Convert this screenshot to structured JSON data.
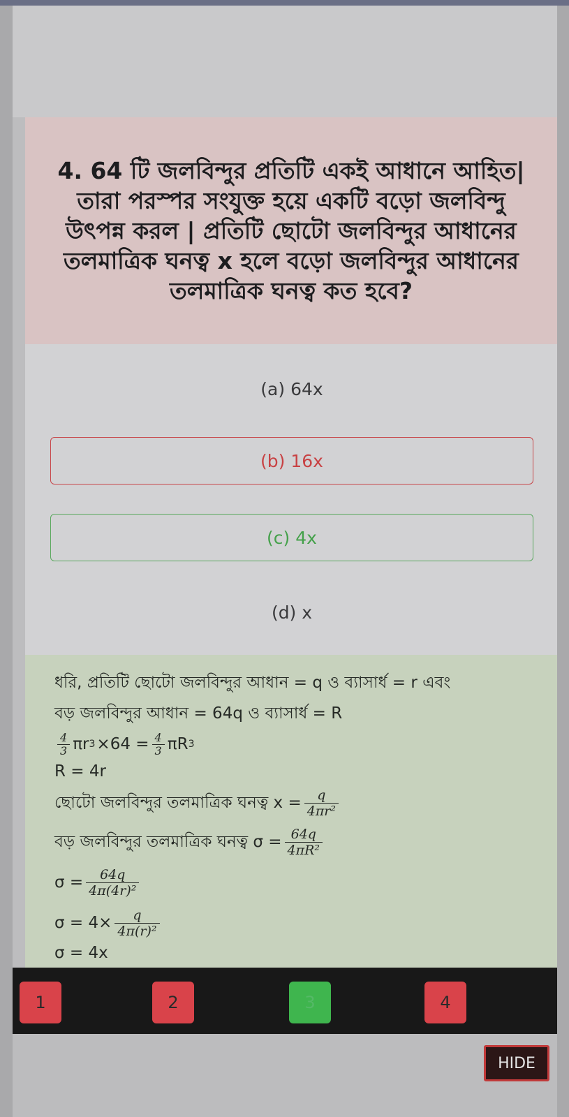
{
  "question": {
    "text": "4. 64 টি জলবিন্দুর প্রতিটি একই আধানে আহিত| তারা পরস্পর সংযুক্ত হয়ে একটি বড়ো জলবিন্দু উৎপন্ন করল | প্রতিটি ছোটো জলবিন্দুর আধানের তলমাত্রিক ঘনত্ব x হলে বড়ো জলবিন্দুর আধানের তলমাত্রিক ঘনত্ব কত হবে?"
  },
  "options": [
    {
      "label": "(a) 64x"
    },
    {
      "label": "(b) 16x"
    },
    {
      "label": "(c) 4x"
    },
    {
      "label": "(d) x"
    }
  ],
  "solution": {
    "line1": "ধরি, প্রতিটি ছোটো জলবিন্দুর আধান = q ও ব্যাসার্ধ = r এবং",
    "line2": "বড় জলবিন্দুর আধান = 64q ও ব্যাসার্ধ = R",
    "eq1_frac_num": "4",
    "eq1_frac_den": "3",
    "eq1_left": "πr",
    "eq1_exp": "3",
    "eq1_mid": "×64 =",
    "eq1_right": "πR",
    "line4": "R = 4r",
    "line5_text": "ছোটো জলবিন্দুর তলমাত্রিক ঘনত্ব x =",
    "line5_num": "q",
    "line5_den": "4πr²",
    "line6_text": "বড় জলবিন্দুর তলমাত্রিক ঘনত্ব σ =",
    "line6_num": "64q",
    "line6_den": "4πR²",
    "line7_text": "σ =",
    "line7_num": "64q",
    "line7_den": "4π(4r)²",
    "line8_text": "σ = 4×",
    "line8_num": "q",
    "line8_den": "4π(r)²",
    "line9": "σ = 4x"
  },
  "nav": {
    "buttons": [
      "1",
      "2",
      "3",
      "4"
    ]
  },
  "hide_label": "HIDE",
  "colors": {
    "question_bg": "#d9c3c3",
    "wrong": "#c7474a",
    "correct": "#5aa85e",
    "solution_bg": "#c7d2bd"
  }
}
